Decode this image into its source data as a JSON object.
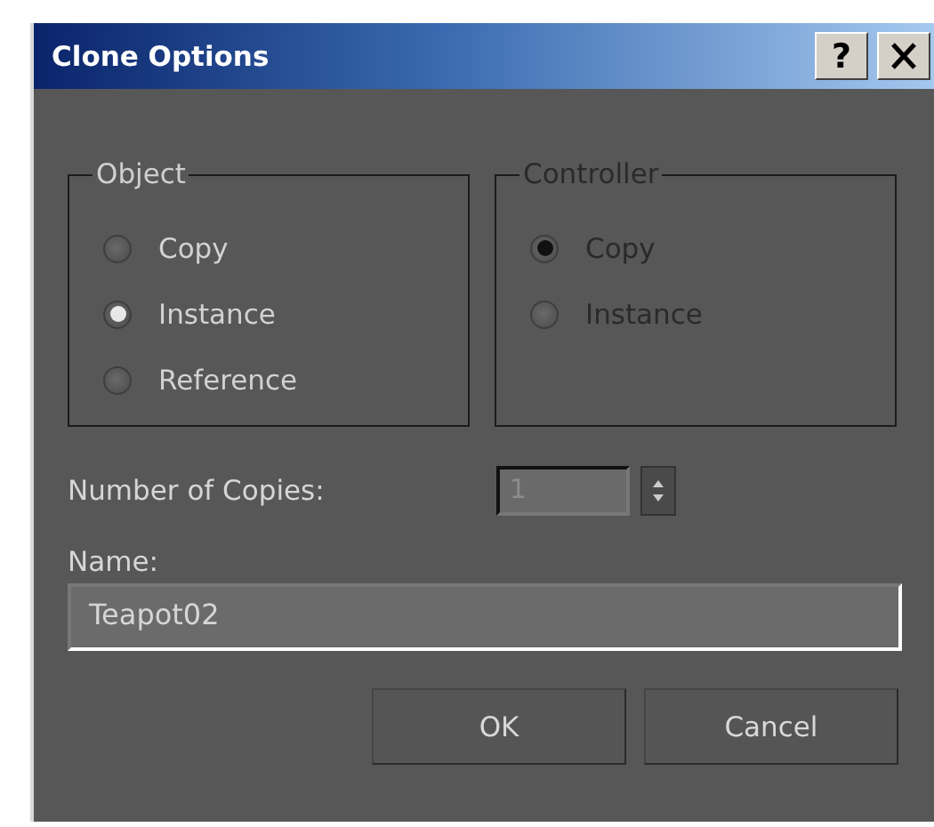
{
  "window": {
    "title": "Clone Options",
    "help_button": "?"
  },
  "groups": [
    {
      "title": "Object",
      "disabled": false,
      "options": [
        {
          "label": "Copy",
          "selected": false
        },
        {
          "label": "Instance",
          "selected": true
        },
        {
          "label": "Reference",
          "selected": false
        }
      ]
    },
    {
      "title": "Controller",
      "disabled": true,
      "options": [
        {
          "label": "Copy",
          "selected": true
        },
        {
          "label": "Instance",
          "selected": false
        }
      ]
    }
  ],
  "copies": {
    "label": "Number of Copies:",
    "value": "1"
  },
  "name": {
    "label": "Name:",
    "value": "Teapot02"
  },
  "buttons": [
    "OK",
    "Cancel"
  ]
}
